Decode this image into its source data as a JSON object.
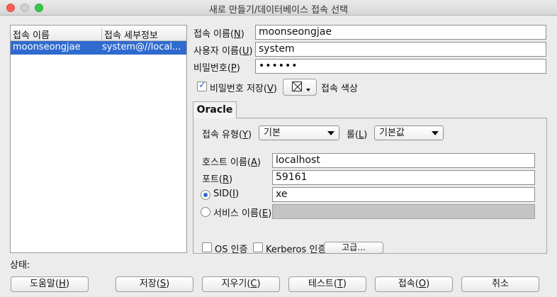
{
  "window": {
    "title": "새로 만들기/데이터베이스 접속 선택"
  },
  "connections": {
    "columns": [
      "접속 이름",
      "접속 세부정보"
    ],
    "rows": [
      {
        "name": "moonseongjae",
        "details": "system@//local..."
      }
    ]
  },
  "form": {
    "conn_name_label": "접속 이름(",
    "conn_name_key": "N",
    "conn_name_value": "moonseongjae",
    "username_label": "사용자 이름(",
    "username_key": "U",
    "username_value": "system",
    "password_label": "비밀번호(",
    "password_key": "P",
    "password_value": "••••••",
    "save_password_label": "비밀번호 저장(",
    "save_password_key": "V",
    "save_password_checked": true,
    "conn_color_label": "접속 색상"
  },
  "tab": {
    "label": "Oracle",
    "conn_type_label": "접속 유형(",
    "conn_type_key": "Y",
    "conn_type_value": "기본",
    "role_label": "롤(",
    "role_key": "L",
    "role_value": "기본값",
    "host_label": "호스트 이름(",
    "host_key": "A",
    "host_value": "localhost",
    "port_label": "포트(",
    "port_key": "R",
    "port_value": "59161",
    "sid_label": "SID(",
    "sid_key": "I",
    "sid_value": "xe",
    "sid_selected": true,
    "service_label": "서비스 이름(",
    "service_key": "E",
    "service_value": "",
    "os_auth_label": "OS 인증",
    "kerberos_label": "Kerberos 인증",
    "advanced_label": "고급..."
  },
  "status": {
    "label": "상태:"
  },
  "buttons": {
    "help": {
      "label": "도움말(",
      "key": "H"
    },
    "save": {
      "label": "저장(",
      "key": "S"
    },
    "clear": {
      "label": "지우기(",
      "key": "C"
    },
    "test": {
      "label": "테스트(",
      "key": "T"
    },
    "connect": {
      "label": "접속(",
      "key": "O"
    },
    "cancel": {
      "label": "취소"
    }
  },
  "colors": {
    "selection": "#2f6bce",
    "window_bg": "#ececec",
    "close": "#fc5f57",
    "zoom": "#35c94a"
  }
}
